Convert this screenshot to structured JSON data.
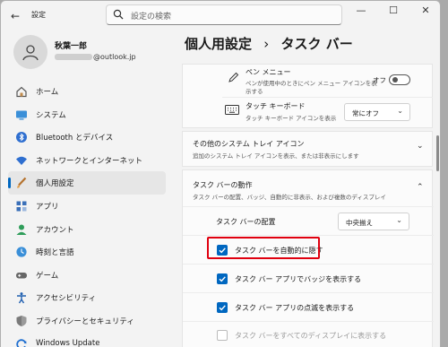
{
  "titlebar": {
    "back_icon": "back-arrow-icon",
    "title": "設定",
    "search_placeholder": "設定の検索",
    "minimize": "—",
    "maximize": "☐",
    "close": "✕"
  },
  "profile": {
    "name": "秋葉一郎",
    "email_domain": "@outlook.jp"
  },
  "sidebar": {
    "items": [
      {
        "label": "ホーム",
        "icon": "home-icon"
      },
      {
        "label": "システム",
        "icon": "monitor-icon"
      },
      {
        "label": "Bluetooth とデバイス",
        "icon": "bluetooth-icon"
      },
      {
        "label": "ネットワークとインターネット",
        "icon": "wifi-icon"
      },
      {
        "label": "個人用設定",
        "icon": "brush-icon",
        "active": true
      },
      {
        "label": "アプリ",
        "icon": "apps-icon"
      },
      {
        "label": "アカウント",
        "icon": "person-icon"
      },
      {
        "label": "時刻と言語",
        "icon": "globe-clock-icon"
      },
      {
        "label": "ゲーム",
        "icon": "gamepad-icon"
      },
      {
        "label": "アクセシビリティ",
        "icon": "accessibility-icon"
      },
      {
        "label": "プライバシーとセキュリティ",
        "icon": "shield-icon"
      },
      {
        "label": "Windows Update",
        "icon": "update-icon"
      }
    ]
  },
  "main": {
    "breadcrumb_parent": "個人用設定",
    "breadcrumb_sep": "›",
    "breadcrumb_current": "タスク バー",
    "pen_menu": {
      "label": "ペン メニュー",
      "desc_line1": "ペンが使用中のときにペン メニュー アイコンを表",
      "desc_line2": "示する",
      "state": "オフ"
    },
    "touch_keyboard": {
      "label": "タッチ キーボード",
      "desc": "タッチ キーボード アイコンを表示",
      "value": "常にオフ"
    },
    "tray_icons": {
      "label": "その他のシステム トレイ アイコン",
      "desc": "追加のシステム トレイ アイコンを表示、または非表示にします"
    },
    "behaviors": {
      "label": "タスク バーの動作",
      "desc": "タスク バーの配置、バッジ、自動的に非表示、および複数のディスプレイ",
      "alignment_label": "タスク バーの配置",
      "alignment_value": "中央揃え",
      "options": [
        {
          "label": "タスク バーを自動的に隠す",
          "checked": true
        },
        {
          "label": "タスク バー アプリでバッジを表示する",
          "checked": true
        },
        {
          "label": "タスク バー アプリの点滅を表示する",
          "checked": true
        },
        {
          "label": "タスク バーをすべてのディスプレイに表示する",
          "checked": false
        }
      ]
    }
  },
  "colors": {
    "accent": "#0067c0",
    "highlight": "#e0000f"
  }
}
